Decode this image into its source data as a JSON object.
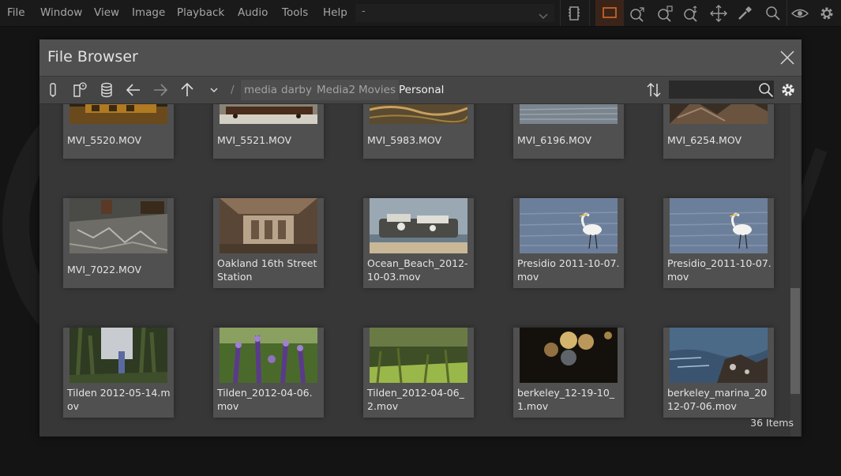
{
  "menu": [
    "File",
    "Window",
    "View",
    "Image",
    "Playback",
    "Audio",
    "Tools",
    "Help"
  ],
  "document_select": {
    "value": "-"
  },
  "toolbar_icons": [
    "film-strip-icon",
    "rectangle-select-icon",
    "zoom-fit-icon",
    "zoom-in-icon",
    "zoom-region-icon",
    "pan-icon",
    "eyedropper-icon",
    "search-icon",
    "view-icon",
    "settings-icon"
  ],
  "file_browser": {
    "title": "File Browser",
    "breadcrumb": [
      {
        "label": "/",
        "kind": "sep"
      },
      {
        "label": "media",
        "kind": "crumb"
      },
      {
        "label": "darby",
        "kind": "crumb"
      },
      {
        "label": "Media2",
        "kind": "crumb"
      },
      {
        "label": "Movies",
        "kind": "crumb"
      },
      {
        "label": "Personal",
        "kind": "current"
      }
    ],
    "search": {
      "value": "",
      "placeholder": ""
    },
    "items": [
      {
        "name": "MVI_5520.MOV"
      },
      {
        "name": "MVI_5521.MOV"
      },
      {
        "name": "MVI_5983.MOV"
      },
      {
        "name": "MVI_6196.MOV"
      },
      {
        "name": "MVI_6254.MOV"
      },
      {
        "name": "MVI_7022.MOV"
      },
      {
        "name": "Oakland 16th Street Station"
      },
      {
        "name": "Ocean_Beach_2012-10-03.mov"
      },
      {
        "name": "Presidio 2011-10-07.mov"
      },
      {
        "name": "Presidio_2011-10-07.mov"
      },
      {
        "name": "Tilden 2012-05-14.mov"
      },
      {
        "name": "Tilden_2012-04-06.mov"
      },
      {
        "name": "Tilden_2012-04-06_2.mov"
      },
      {
        "name": "berkeley_12-19-10_1.mov"
      },
      {
        "name": "berkeley_marina_2012-07-06.mov"
      }
    ],
    "item_count": "36 Items"
  }
}
